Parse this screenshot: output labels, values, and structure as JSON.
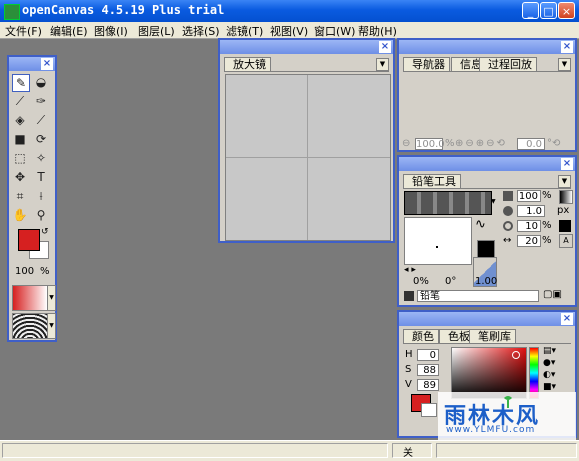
{
  "window": {
    "title": "openCanvas 4.5.19 Plus trial",
    "buttons": {
      "minimize": "_",
      "maximize": "□",
      "close": "×"
    }
  },
  "menu": {
    "items": [
      "文件(F)",
      "编辑(E)",
      "图像(I)",
      "图层(L)",
      "选择(S)",
      "滤镜(T)",
      "视图(V)",
      "窗口(W)",
      "帮助(H)"
    ]
  },
  "toolbox": {
    "zoom_value": "100",
    "zoom_unit": "%",
    "icons": [
      "pencil-icon",
      "eraser-icon",
      "brush-icon",
      "airbrush-icon",
      "dropper-fill-icon",
      "knife-icon",
      "rect-fill-icon",
      "rotate-icon",
      "select-rect-icon",
      "magic-wand-icon",
      "move-icon",
      "text-icon",
      "crop-icon",
      "eyedropper-icon",
      "hand-icon",
      "magnifier-icon"
    ],
    "primary_color": "#d62020",
    "secondary_color": "#ffffff"
  },
  "magnifier": {
    "tab": "放大镜",
    "close": "×"
  },
  "navigator": {
    "tabs": [
      "导航器",
      "信息",
      "过程回放"
    ],
    "zoom_value": "100.0",
    "angle_value": "0.0",
    "close": "×"
  },
  "pencil": {
    "tab": "铅笔工具",
    "size_value": "100",
    "thickness_value": "1.0",
    "thickness_unit": "px",
    "density_value": "10",
    "spacing_value": "20",
    "pct": "%",
    "pressure_low": "0%",
    "pressure_angle": "0°",
    "pressure_value": "1.00",
    "tool_name": "铅笔",
    "close": "×"
  },
  "color": {
    "tabs": [
      "颜色",
      "色板",
      "笔刷库"
    ],
    "h_label": "H",
    "s_label": "S",
    "v_label": "V",
    "h_value": "0",
    "s_value": "88",
    "v_value": "89",
    "close": "×"
  },
  "statusbar": {
    "text": "关"
  },
  "watermark": {
    "brand": "雨林木风",
    "url": "www.YLMFU.com"
  }
}
